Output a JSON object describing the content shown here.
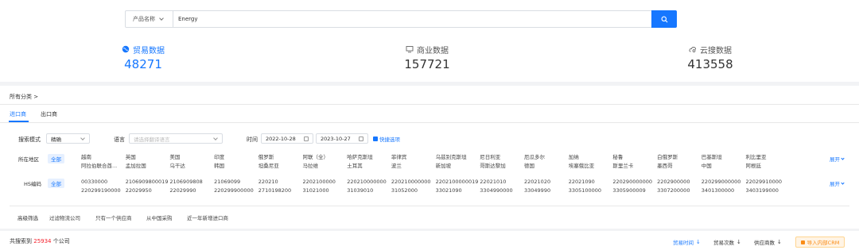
{
  "search": {
    "field_select": "产品名称",
    "query": "Energy",
    "search_icon": "search-icon"
  },
  "stats": [
    {
      "label": "贸易数据",
      "value": "48271",
      "icon": "globe-icon",
      "active": true
    },
    {
      "label": "商业数据",
      "value": "157721",
      "icon": "monitor-icon",
      "active": false
    },
    {
      "label": "云搜数据",
      "value": "413558",
      "icon": "cloud-search-icon",
      "active": false
    }
  ],
  "category": {
    "label": "所有分类",
    "chevron": ">"
  },
  "tabs": [
    {
      "label": "进口商",
      "active": true
    },
    {
      "label": "出口商",
      "active": false
    }
  ],
  "filters": {
    "search_mode_label": "搜索模式",
    "search_mode_value": "精确",
    "language_label": "语言",
    "language_placeholder": "请选择翻译语言",
    "time_label": "时间",
    "date_from": "2022-10-28",
    "date_to": "2023-10-27",
    "quick_select": "快捷选项"
  },
  "region": {
    "label": "所在地区",
    "all": "全部",
    "items": [
      [
        "越南",
        "阿拉伯联合酋..."
      ],
      [
        "英国",
        "孟加拉国"
      ],
      [
        "美国",
        "乌干达"
      ],
      [
        "印度",
        "韩国"
      ],
      [
        "俄罗斯",
        "坦桑尼亚"
      ],
      [
        "阿联（全）",
        "马拉维"
      ],
      [
        "哈萨克斯坦",
        "土耳其"
      ],
      [
        "菲律宾",
        "波兰"
      ],
      [
        "乌兹别克斯坦",
        "新加坡"
      ],
      [
        "尼日利亚",
        "哥斯达黎加"
      ],
      [
        "厄瓜多尔",
        "德国"
      ],
      [
        "加纳",
        "埃塞俄比亚"
      ],
      [
        "秘鲁",
        "斯里兰卡"
      ],
      [
        "白俄罗斯",
        "墨西哥"
      ],
      [
        "巴基斯坦",
        "中国"
      ],
      [
        "利比里亚",
        "阿根廷"
      ]
    ],
    "expand": "展开"
  },
  "hs": {
    "label": "HS编码",
    "all": "全部",
    "items": [
      [
        "00330000",
        "220299190000"
      ],
      [
        "2106909800019",
        "22029950"
      ],
      [
        "2106909808",
        "22029990"
      ],
      [
        "21069099",
        "220299900000"
      ],
      [
        "220210",
        "2710198200"
      ],
      [
        "2202100000",
        "31021000"
      ],
      [
        "220210000000",
        "31039010"
      ],
      [
        "220210000000",
        "31052000"
      ],
      [
        "2202100000019",
        "33021090"
      ],
      [
        "22021010",
        "3304990000"
      ],
      [
        "22021020",
        "33049990"
      ],
      [
        "22021090",
        "3305100000"
      ],
      [
        "220290000000",
        "3305900009"
      ],
      [
        "2202900000",
        "3307200000"
      ],
      [
        "220299000000",
        "3401300000"
      ],
      [
        "22029910000",
        "3403199000"
      ]
    ],
    "expand": "展开"
  },
  "advanced": {
    "label": "高级筛选",
    "options": [
      "过滤物流公司",
      "只有一个供应商",
      "从中国采购",
      "近一年新增进口商"
    ]
  },
  "results": {
    "prefix": "共搜索到",
    "count": "25934",
    "suffix": "个公司",
    "sort_options": [
      {
        "label": "贸易时间",
        "active": true
      },
      {
        "label": "贸易次数",
        "active": false
      },
      {
        "label": "供应商数",
        "active": false
      }
    ],
    "crm_button": "导入内部CRM"
  },
  "colors": {
    "accent": "#1677ff",
    "count": "#f5222d",
    "crm": "#fa8c16"
  }
}
